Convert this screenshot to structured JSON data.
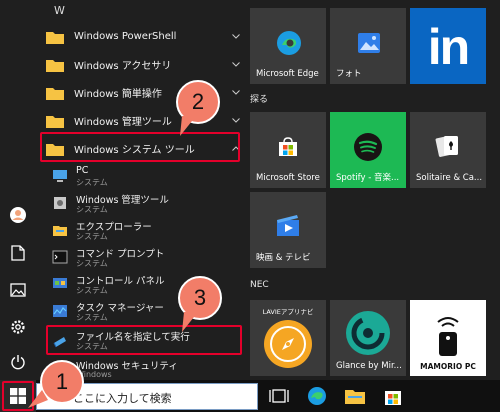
{
  "app_list": {
    "section_letter": "W",
    "folders": [
      {
        "label": "Windows PowerShell",
        "chevron": "down"
      },
      {
        "label": "Windows アクセサリ",
        "chevron": "down"
      },
      {
        "label": "Windows 簡単操作",
        "chevron": "down"
      },
      {
        "label": "Windows 管理ツール",
        "chevron": "down"
      },
      {
        "label": "Windows システム ツール",
        "chevron": "up"
      }
    ],
    "apps": [
      {
        "name": "PC",
        "sub": "システム",
        "icon": "pc-icon"
      },
      {
        "name": "Windows 管理ツール",
        "sub": "システム",
        "icon": "admin-tools-icon"
      },
      {
        "name": "エクスプローラー",
        "sub": "システム",
        "icon": "explorer-icon"
      },
      {
        "name": "コマンド プロンプト",
        "sub": "システム",
        "icon": "cmd-icon"
      },
      {
        "name": "コントロール パネル",
        "sub": "システム",
        "icon": "control-panel-icon"
      },
      {
        "name": "タスク マネージャー",
        "sub": "システム",
        "icon": "task-manager-icon"
      },
      {
        "name": "ファイル名を指定して実行",
        "sub": "システム",
        "icon": "run-icon"
      },
      {
        "name": "Windows セキュリティ",
        "sub": "Windows",
        "icon": "security-icon"
      }
    ]
  },
  "tiles": {
    "row1": [
      {
        "label": "Microsoft Edge",
        "icon": "edge-icon"
      },
      {
        "label": "フォト",
        "icon": "photos-icon"
      },
      {
        "label": "",
        "icon": "linkedin-icon"
      }
    ],
    "section_explore": "探る",
    "row2": [
      {
        "label": "Microsoft Store",
        "icon": "store-icon"
      },
      {
        "label": "Spotify - 音楽...",
        "icon": "spotify-icon"
      },
      {
        "label": "Solitaire & Ca...",
        "icon": "solitaire-icon"
      }
    ],
    "row3": [
      {
        "label": "映画 & テレビ",
        "icon": "movies-icon"
      }
    ],
    "section_nec": "NEC",
    "row4": [
      {
        "label": "LAVIEアプリナビ",
        "icon": "compass-icon"
      },
      {
        "label": "Glance by Mir...",
        "icon": "glance-icon"
      },
      {
        "label": "MAMORIO PC",
        "icon": "mamorio-icon"
      }
    ]
  },
  "taskbar": {
    "search_placeholder": "ここに入力して検索"
  },
  "badges": [
    "1",
    "2",
    "3"
  ],
  "colors": {
    "highlight": "#e4002b",
    "badge": "#f27d68",
    "spotify_tile": "#1db954",
    "linkedin_tile": "#0a66c2",
    "folder": "#f6c343"
  }
}
